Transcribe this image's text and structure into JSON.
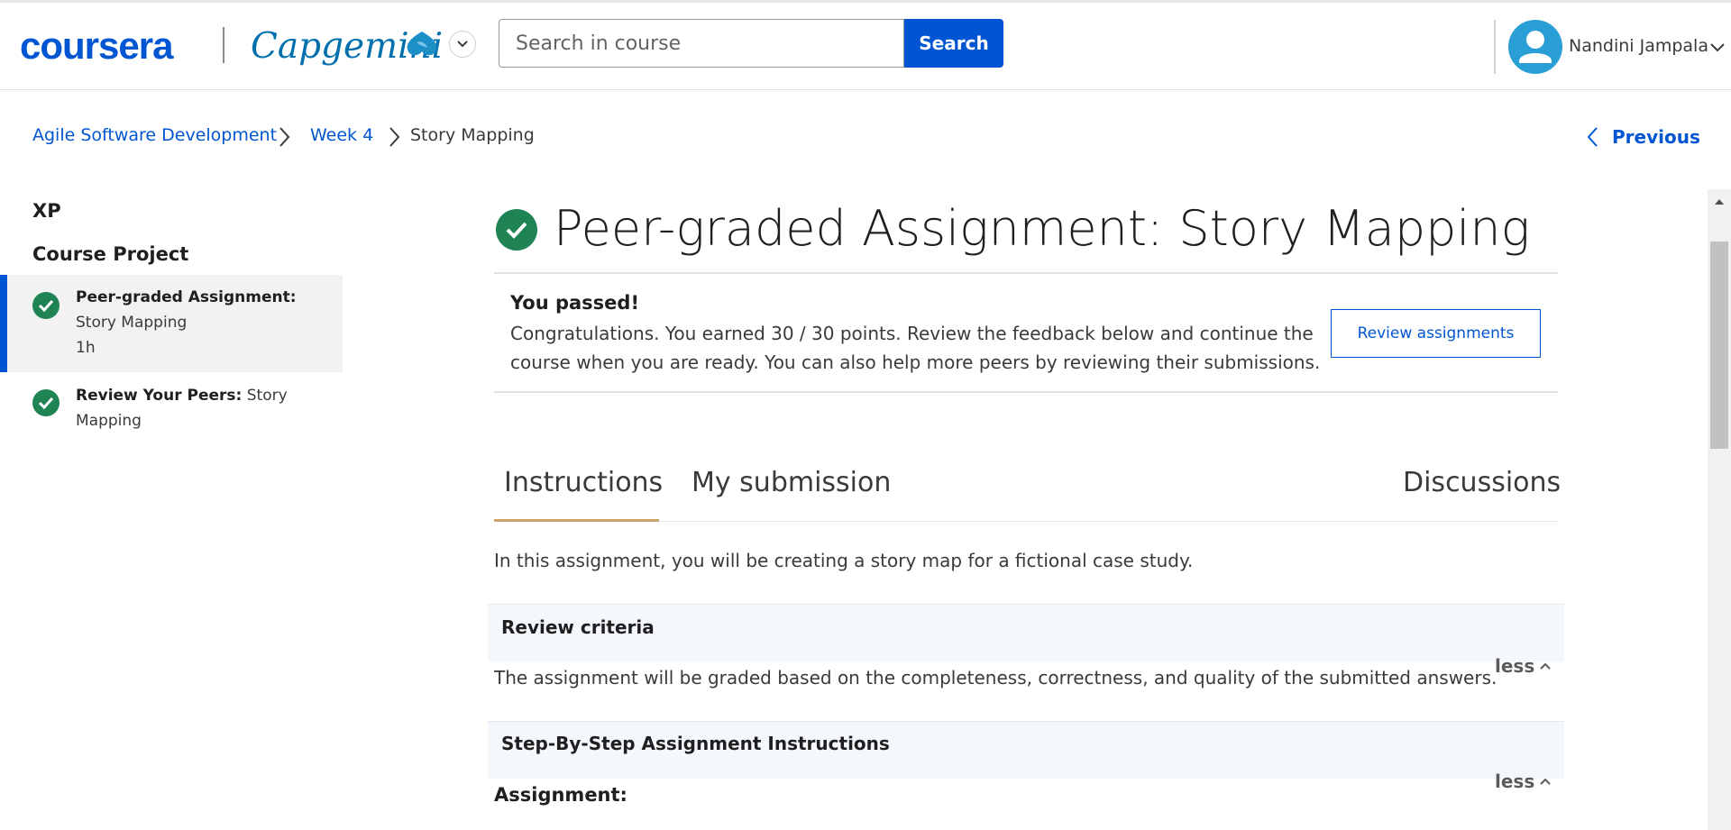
{
  "header": {
    "logo_text": "coursera",
    "partner_logo_text": "Capgemini",
    "search": {
      "placeholder": "Search in course",
      "value": ""
    },
    "search_button_label": "Search",
    "user_name": "Nandini Jampala"
  },
  "breadcrumb": {
    "items": [
      "Agile Software Development",
      "Week 4",
      "Story Mapping"
    ],
    "previous_label": "Previous"
  },
  "sidebar": {
    "xp_label": "XP",
    "section_title": "Course Project",
    "items": [
      {
        "title_bold": "Peer-graded Assignment:",
        "title_rest": "Story Mapping",
        "duration": "1h",
        "status": "completed",
        "active": true
      },
      {
        "title_bold": "Review Your Peers:",
        "title_rest": "Story Mapping",
        "status": "completed",
        "active": false
      }
    ]
  },
  "main": {
    "title": "Peer-graded Assignment: Story Mapping",
    "banner": {
      "title": "You passed!",
      "body": "Congratulations. You earned 30 / 30 points. Review the feedback below and continue the course when you are ready. You can also help more peers by reviewing their submissions.",
      "button_label": "Review assignments"
    },
    "tabs": [
      {
        "label": "Instructions",
        "selected": true
      },
      {
        "label": "My submission",
        "selected": false
      },
      {
        "label": "Discussions",
        "selected": false
      }
    ],
    "intro": "In this assignment, you will be creating a story map for a fictional case study.",
    "sections": [
      {
        "title": "Review criteria",
        "toggle_label": "less",
        "body": "The assignment will be graded based on the completeness, correctness, and quality of the submitted answers."
      },
      {
        "title": "Step-By-Step Assignment Instructions",
        "toggle_label": "less",
        "body": "Assignment:"
      }
    ]
  },
  "colors": {
    "brand": "#0056d2",
    "success": "#1f8354",
    "tab_accent": "#c9a36a"
  },
  "icons": [
    "check-circle-icon",
    "chevron-right-icon",
    "chevron-left-icon",
    "chevron-down-icon",
    "chevron-up-icon",
    "user-avatar-icon"
  ]
}
